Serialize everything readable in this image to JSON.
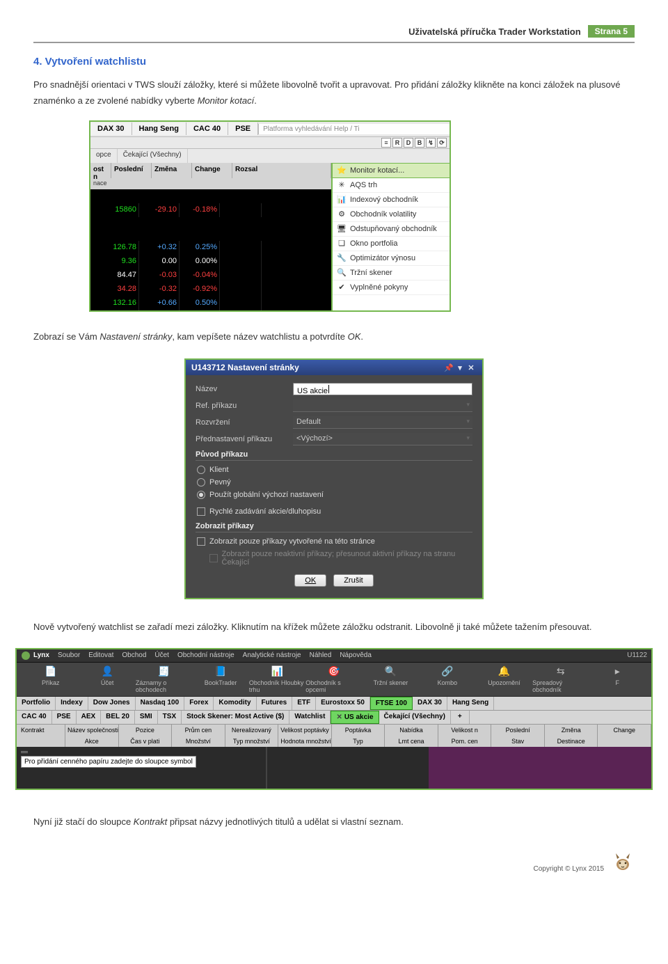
{
  "header": {
    "title": "Uživatelská příručka Trader Workstation",
    "page_label": "Strana 5"
  },
  "section": {
    "title": "4. Vytvoření watchlistu",
    "para1_a": "Pro snadnější orientaci v TWS slouží záložky, které si můžete libovolně tvořit a upravovat. Pro přidání záložky klikněte na konci záložek na plusové znaménko a ze zvolené nabídky vyberte ",
    "para1_em": "Monitor kotací",
    "para1_c": ".",
    "para2_a": "Zobrazí se Vám ",
    "para2_em": "Nastavení stránky",
    "para2_b": ", kam vepíšete název watchlistu a potvrdíte ",
    "para2_em2": "OK",
    "para2_c": ".",
    "para3": "Nově vytvořený watchlist se zařadí mezi záložky. Kliknutím na křížek můžete záložku odstranit. Libovolně ji také můžete tažením přesouvat.",
    "para4_a": "Nyní již stačí do sloupce ",
    "para4_em": "Kontrakt",
    "para4_b": " připsat názvy jednotlivých titulů a udělat si vlastní seznam."
  },
  "shot1": {
    "tabs": [
      "DAX 30",
      "Hang Seng",
      "CAC 40",
      "PSE"
    ],
    "search_placeholder": "Platforma vyhledávání Help / Ti",
    "subtabs": [
      "opce",
      "Čekající (Všechny)"
    ],
    "mini_buttons": [
      "≡",
      "R",
      "D",
      "B",
      "↯",
      "⟳"
    ],
    "headers": [
      "ost n",
      "Poslední",
      "Změna",
      "Change",
      "Rozsal"
    ],
    "left_corner": "nace",
    "menu": [
      {
        "icon": "⭐",
        "label": "Monitor kotací...",
        "sel": true
      },
      {
        "icon": "✳",
        "label": "AQS trh"
      },
      {
        "icon": "📊",
        "label": "Indexový obchodník"
      },
      {
        "icon": "⚙",
        "label": "Obchodník volatility"
      },
      {
        "icon": "🖥",
        "label": "Odstupňovaný obchodník"
      },
      {
        "icon": "❏",
        "label": "Okno portfolia"
      },
      {
        "icon": "🔧",
        "label": "Optimizátor výnosu"
      },
      {
        "icon": "🔍",
        "label": "Tržní skener"
      },
      {
        "icon": "✔",
        "label": "Vyplněné pokyny"
      }
    ],
    "rows": [
      {
        "a": "15860",
        "b": "-29.10",
        "c": "-0.18%",
        "a_cls": "pos-green",
        "b_cls": "neg-red",
        "c_cls": "neg-red"
      },
      {
        "a": "126.78",
        "b": "+0.32",
        "c": "0.25%",
        "a_cls": "pos-green",
        "b_cls": "pos-blue",
        "c_cls": "pos-blue"
      },
      {
        "a": "9.36",
        "b": "0.00",
        "c": "0.00%",
        "a_cls": "pos-green",
        "b_cls": "white",
        "c_cls": "white"
      },
      {
        "a": "84.47",
        "b": "-0.03",
        "c": "-0.04%",
        "a_cls": "white",
        "b_cls": "neg-red",
        "c_cls": "neg-red"
      },
      {
        "a": "34.28",
        "b": "-0.32",
        "c": "-0.92%",
        "a_cls": "neg-red",
        "b_cls": "neg-red",
        "c_cls": "neg-red"
      },
      {
        "a": "132.16",
        "b": "+0.66",
        "c": "0.50%",
        "a_cls": "pos-green",
        "b_cls": "pos-blue",
        "c_cls": "pos-blue"
      }
    ]
  },
  "shot2": {
    "title": "U143712 Nastavení stránky",
    "fields": {
      "name_label": "Název",
      "name_value": "US akcie",
      "ref_label": "Ref. příkazu",
      "layout_label": "Rozvržení",
      "layout_value": "Default",
      "preset_label": "Přednastavení příkazu",
      "preset_value": "<Výchozí>"
    },
    "origin_head": "Původ příkazu",
    "radios": [
      {
        "label": "Klient",
        "on": false
      },
      {
        "label": "Pevný",
        "on": false
      },
      {
        "label": "Použít globální výchozí nastavení",
        "on": true
      }
    ],
    "cb_quick": "Rychlé zadávání akcie/dluhopisu",
    "show_head": "Zobrazit příkazy",
    "cb_show1": "Zobrazit pouze příkazy vytvořené na této stránce",
    "cb_show2": "Zobrazit pouze neaktivní příkazy; přesunout aktivní příkazy na stranu Čekající",
    "ok": "OK",
    "cancel": "Zrušit"
  },
  "shot3": {
    "logo": "Lynx",
    "menu": [
      "Soubor",
      "Editovat",
      "Obchod",
      "Účet",
      "Obchodní nástroje",
      "Analytické nástroje",
      "Náhled",
      "Nápověda"
    ],
    "account": "U1122",
    "toolbar": [
      {
        "icon": "📄",
        "label": "Příkaz"
      },
      {
        "icon": "👤",
        "label": "Účet"
      },
      {
        "icon": "🧾",
        "label": "Záznamy o obchodech"
      },
      {
        "icon": "📘",
        "label": "BookTrader"
      },
      {
        "icon": "📊",
        "label": "Obchodník Hloubky trhu"
      },
      {
        "icon": "🎯",
        "label": "Obchodník s opcemi"
      },
      {
        "icon": "🔍",
        "label": "Tržní skener"
      },
      {
        "icon": "🔗",
        "label": "Kombo"
      },
      {
        "icon": "🔔",
        "label": "Upozornění"
      },
      {
        "icon": "⇆",
        "label": "Spreadový obchodník"
      },
      {
        "icon": "▸",
        "label": "F"
      }
    ],
    "tabs_row1": [
      "Portfolio",
      "Indexy",
      "Dow Jones",
      "Nasdaq 100",
      "Forex",
      "Komodity",
      "Futures",
      "ETF",
      "Eurostoxx 50",
      "FTSE 100",
      "DAX 30",
      "Hang Seng"
    ],
    "tabs_row2_left": [
      "CAC 40",
      "PSE",
      "AEX",
      "BEL 20",
      "SMI",
      "TSX",
      "Stock Skener: Most Active ($)",
      "Watchlist"
    ],
    "tabs_row2_active": "US akcie",
    "tabs_row2_right": [
      "Čekající (Všechny)"
    ],
    "grid_top": [
      "Kontrakt",
      "Název společnosti",
      "Pozice",
      "Prům cen",
      "Nerealizovaný",
      "Velikost poptávky",
      "Poptávka",
      "Nabídka",
      "Velikost n",
      "Poslední",
      "Změna",
      "Change"
    ],
    "grid_bottom": [
      "",
      "Akce",
      "Čas v plati",
      "Množství",
      "Typ množství",
      "Hodnota množství",
      "Typ",
      "Lmt cena",
      "Pom. cen",
      "Stav",
      "Destinace",
      ""
    ],
    "prompt": "Pro přidání cenného papíru zadejte do sloupce symbol"
  },
  "footer": {
    "copyright": "Copyright © Lynx 2015"
  }
}
